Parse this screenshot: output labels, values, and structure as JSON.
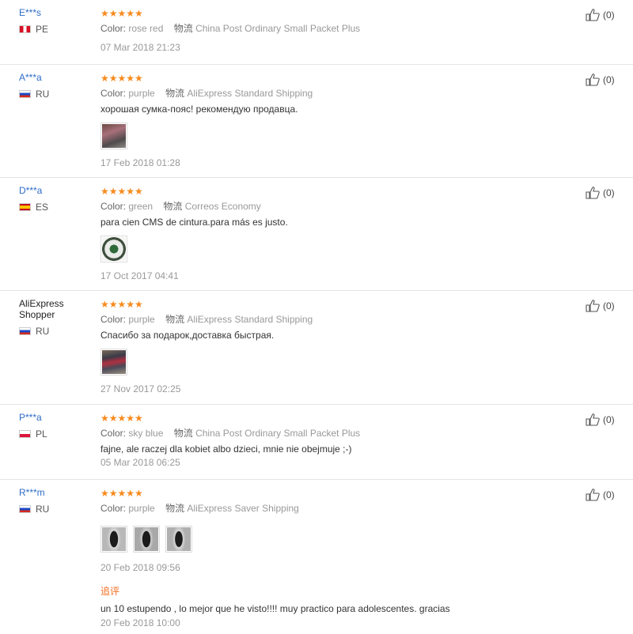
{
  "helpful_count": "(0)",
  "stars_text": "★★★★★",
  "color_key": "Color:",
  "logistics_key": "物流",
  "reviews": [
    {
      "user": "E***s",
      "country": "PE",
      "color": "rose red",
      "shipping": "China Post Ordinary Small Packet Plus",
      "text": "",
      "date": "07 Mar 2018 21:23"
    },
    {
      "user": "A***a",
      "country": "RU",
      "color": "purple",
      "shipping": "AliExpress Standard Shipping",
      "text": "хорошая сумка-пояс! рекомендую продавца.",
      "date": "17 Feb 2018 01:28"
    },
    {
      "user": "D***a",
      "country": "ES",
      "color": "green",
      "shipping": "Correos Economy",
      "text": "para cien CMS de cintura.para más es justo.",
      "date": "17 Oct 2017 04:41"
    },
    {
      "user": "AliExpress Shopper",
      "country": "RU",
      "color": "purple",
      "shipping": "AliExpress Standard Shipping",
      "text": "Спасибо за подарок,доставка быстрая.",
      "date": "27 Nov 2017 02:25"
    },
    {
      "user": "P***a",
      "country": "PL",
      "color": "sky blue",
      "shipping": "China Post Ordinary Small Packet Plus",
      "text": "fajne, ale raczej dla kobiet albo dzieci, mnie nie obejmuje ;-)",
      "date": "05 Mar 2018 06:25"
    },
    {
      "user": "R***m",
      "country": "RU",
      "color": "purple",
      "shipping": "AliExpress Saver Shipping",
      "text": "",
      "date": "20 Feb 2018 09:56",
      "additional": {
        "label": "追评",
        "text": "un 10 estupendo , lo mejor que he visto!!!! muy practico para adolescentes. gracias",
        "date": "20 Feb 2018 10:00"
      }
    }
  ]
}
